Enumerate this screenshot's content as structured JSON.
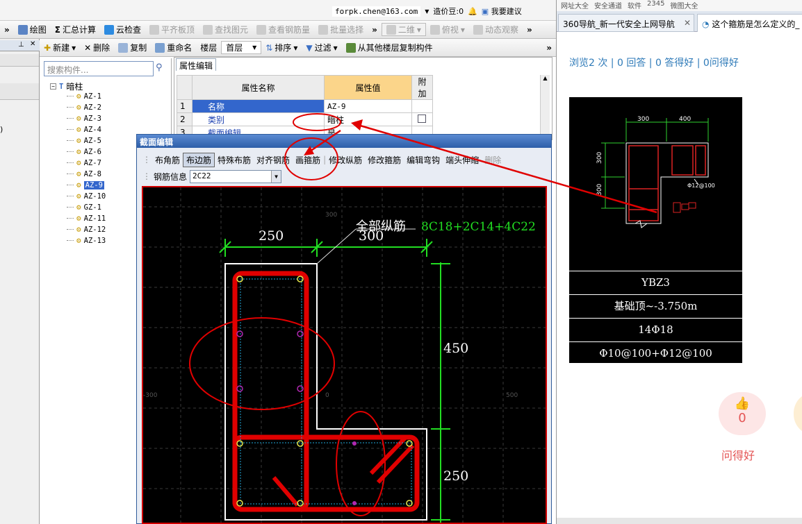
{
  "account": {
    "email": "forpk.chen@163.com",
    "zaojiadou": "造价豆:0",
    "suggest": "我要建议"
  },
  "toolbar1": [
    {
      "label": "绘图",
      "icon": "draw-icon",
      "enabled": true
    },
    {
      "label": "汇总计算",
      "icon": "sum-icon",
      "enabled": true
    },
    {
      "label": "云检查",
      "icon": "cloud-check-icon",
      "enabled": true
    },
    {
      "label": "平齐板顶",
      "icon": "align-slab-icon",
      "enabled": false
    },
    {
      "label": "查找图元",
      "icon": "find-element-icon",
      "enabled": false
    },
    {
      "label": "查看钢筋量",
      "icon": "rebar-qty-icon",
      "enabled": false
    },
    {
      "label": "批量选择",
      "icon": "batch-select-icon",
      "enabled": false
    },
    {
      "label": "二维",
      "icon": "2d-icon",
      "enabled": false
    },
    {
      "label": "俯视",
      "icon": "top-view-icon",
      "enabled": false
    },
    {
      "label": "动态观察",
      "icon": "orbit-icon",
      "enabled": false
    }
  ],
  "toolbar2": {
    "new": "新建",
    "delete": "删除",
    "copy": "复制",
    "rename": "重命名",
    "floor_label": "楼层",
    "floor_value": "首层",
    "sort": "排序",
    "filter": "过滤",
    "copy_from": "从其他楼层复制构件"
  },
  "tree": {
    "search_placeholder": "搜索构件...",
    "root": "暗柱",
    "items": [
      "AZ-1",
      "AZ-2",
      "AZ-3",
      "AZ-4",
      "AZ-5",
      "AZ-6",
      "AZ-7",
      "AZ-8",
      "AZ-9",
      "AZ-10",
      "GZ-1",
      "AZ-11",
      "AZ-12",
      "AZ-13"
    ],
    "selected": "AZ-9"
  },
  "prop_editor": {
    "tab": "属性编辑",
    "headers": [
      "属性名称",
      "属性值",
      "附加"
    ],
    "rows": [
      {
        "n": "1",
        "name": "名称",
        "value": "AZ-9"
      },
      {
        "n": "2",
        "name": "类别",
        "value": "暗柱"
      },
      {
        "n": "3",
        "name": "截面编辑",
        "value": "是"
      }
    ]
  },
  "dialog": {
    "title": "截面编辑",
    "buttons": [
      "布角筋",
      "布边筋",
      "特殊布筋",
      "对齐钢筋",
      "画箍筋",
      "修改纵筋",
      "修改箍筋",
      "编辑弯钩",
      "端头伸缩",
      "删除"
    ],
    "active": "布边筋",
    "rebar_label": "钢筋信息",
    "rebar_value": "2C22",
    "canvas": {
      "dim_250_top": "250",
      "dim_300_top": "300",
      "dim_450": "450",
      "dim_250_right": "250",
      "label": "全部纵筋",
      "spec": "8C18+2C14+4C22",
      "grid_300": "300",
      "grid_0": "0",
      "grid_n300": "-300",
      "grid_500": "500"
    }
  },
  "browser": {
    "bookmarks": [
      "网址大全",
      "安全通道",
      "软件",
      "2345",
      "微图大全"
    ],
    "tabs": [
      "360导航_新一代安全上网导航",
      "这个箍筋是怎么定义的_"
    ],
    "stats": "浏览2 次 | 0 回答 | 0 答得好 | 0问得好",
    "drawing": {
      "dim_a": "300",
      "dim_b": "400",
      "dim_c": "300",
      "dim_d": "300",
      "note": "Φ12@100"
    },
    "table": [
      "YBZ3",
      "基础顶~-3.750m",
      "14Φ18",
      "Φ10@100+Φ12@100"
    ],
    "like_count": "0",
    "like_label": "问得好"
  }
}
